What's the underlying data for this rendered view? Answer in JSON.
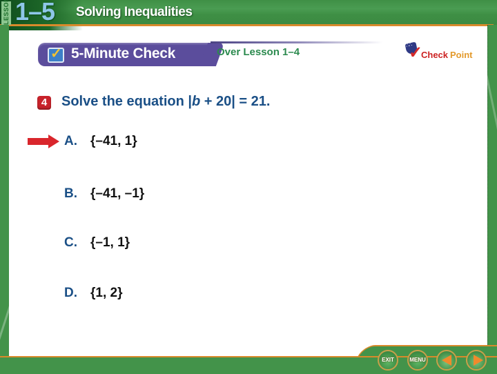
{
  "header": {
    "lesson_label": "LESSON",
    "lesson_number": "1–5",
    "lesson_title": "Solving Inequalities"
  },
  "banner": {
    "title": "5-Minute Check",
    "subtitle": "Over Lesson 1–4",
    "icon": "checkbox-icon"
  },
  "logo": {
    "part1": "Check",
    "part2": "Point",
    "icon": "checkpoint-logo-icon"
  },
  "question": {
    "number": "4",
    "text_before": "Solve the equation |",
    "variable": "b",
    "text_after": " + 20| = 21."
  },
  "answers": [
    {
      "letter": "A.",
      "value": "{–41, 1}",
      "selected": true
    },
    {
      "letter": "B.",
      "value": "{–41, –1}",
      "selected": false
    },
    {
      "letter": "C.",
      "value": "{–1, 1}",
      "selected": false
    },
    {
      "letter": "D.",
      "value": "{1, 2}",
      "selected": false
    }
  ],
  "nav": {
    "exit_label": "EXIT",
    "menu_label": "MENU",
    "prev_icon": "triangle-left-icon",
    "next_icon": "triangle-right-icon"
  },
  "colors": {
    "frame_green": "#43934a",
    "accent_orange": "#d98a2b",
    "banner_purple": "#5b4d9c",
    "question_blue": "#1a4f86",
    "arrow_red": "#d9262c"
  }
}
